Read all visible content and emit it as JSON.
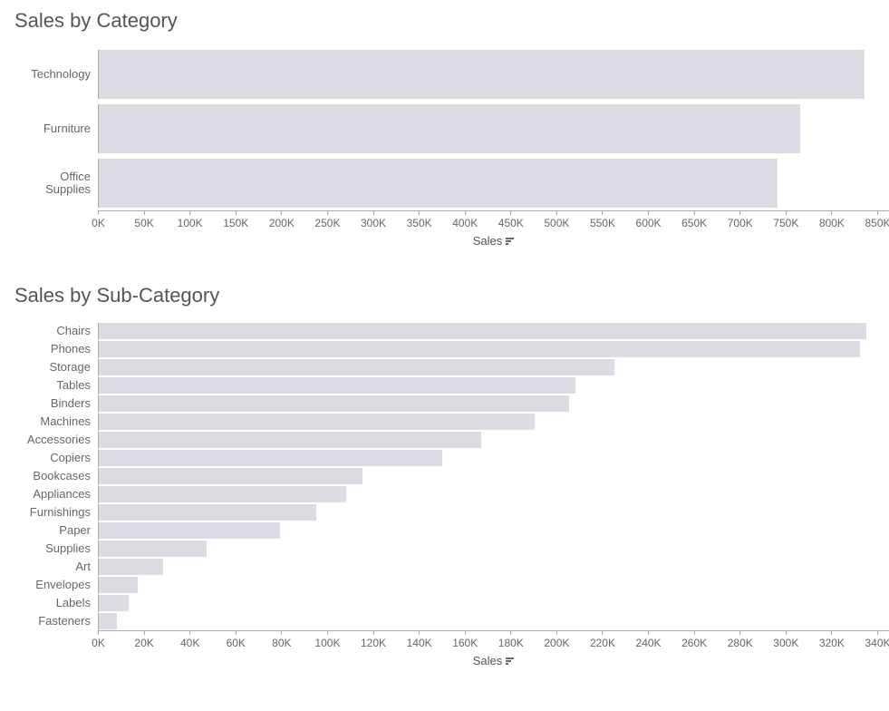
{
  "chart_data": [
    {
      "type": "bar",
      "orientation": "horizontal",
      "title": "Sales by Category",
      "xlabel": "Sales",
      "ylabel": "",
      "xlim": [
        0,
        850000
      ],
      "xticks": [
        0,
        50000,
        100000,
        150000,
        200000,
        250000,
        300000,
        350000,
        400000,
        450000,
        500000,
        550000,
        600000,
        650000,
        700000,
        750000,
        800000,
        850000
      ],
      "xtick_labels": [
        "0K",
        "50K",
        "100K",
        "150K",
        "200K",
        "250K",
        "300K",
        "350K",
        "400K",
        "450K",
        "500K",
        "550K",
        "600K",
        "650K",
        "700K",
        "750K",
        "800K",
        "850K"
      ],
      "categories": [
        "Technology",
        "Furniture",
        "Office Supplies"
      ],
      "values": [
        835000,
        765000,
        740000
      ]
    },
    {
      "type": "bar",
      "orientation": "horizontal",
      "title": "Sales by Sub-Category",
      "xlabel": "Sales",
      "ylabel": "",
      "xlim": [
        0,
        340000
      ],
      "xticks": [
        0,
        20000,
        40000,
        60000,
        80000,
        100000,
        120000,
        140000,
        160000,
        180000,
        200000,
        220000,
        240000,
        260000,
        280000,
        300000,
        320000,
        340000
      ],
      "xtick_labels": [
        "0K",
        "20K",
        "40K",
        "60K",
        "80K",
        "100K",
        "120K",
        "140K",
        "160K",
        "180K",
        "200K",
        "220K",
        "240K",
        "260K",
        "280K",
        "300K",
        "320K",
        "340K"
      ],
      "categories": [
        "Chairs",
        "Phones",
        "Storage",
        "Tables",
        "Binders",
        "Machines",
        "Accessories",
        "Copiers",
        "Bookcases",
        "Appliances",
        "Furnishings",
        "Paper",
        "Supplies",
        "Art",
        "Envelopes",
        "Labels",
        "Fasteners"
      ],
      "values": [
        335000,
        332000,
        225000,
        208000,
        205000,
        190000,
        167000,
        150000,
        115000,
        108000,
        95000,
        79000,
        47000,
        28000,
        17000,
        13000,
        8000
      ]
    }
  ]
}
